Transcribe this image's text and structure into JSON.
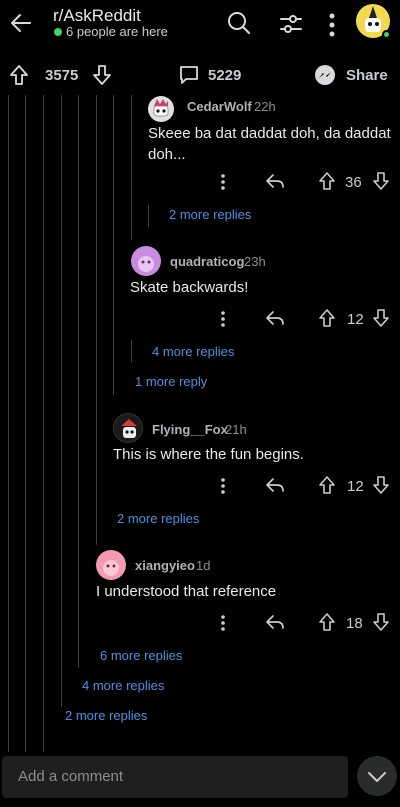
{
  "header": {
    "subreddit": "r/AskReddit",
    "presence": "6 people are here",
    "presence_color": "#46d160"
  },
  "post_bar": {
    "upvotes": "3575",
    "comments": "5229",
    "share_label": "Share"
  },
  "comments": [
    {
      "username": "CedarWolf",
      "age": "22h",
      "text": "Skeee ba dat daddat doh, da daddat doh...",
      "score": "36"
    },
    {
      "username": "quadraticog",
      "age": "23h",
      "text": "Skate backwards!",
      "score": "12"
    },
    {
      "username": "Flying__Fox",
      "age": "21h",
      "text": "This is where the fun begins.",
      "score": "12"
    },
    {
      "username": "xiangyieo",
      "age": "1d",
      "text": "I understood that reference",
      "score": "18"
    }
  ],
  "more_replies": [
    "2 more replies",
    "4 more replies",
    "1 more reply",
    "2 more replies",
    "6 more replies",
    "4 more replies",
    "2 more replies"
  ],
  "composer": {
    "placeholder": "Add a comment"
  },
  "colors": {
    "link": "#4f8fe0",
    "background": "#000000",
    "thread_line": "#3d3d3d"
  }
}
